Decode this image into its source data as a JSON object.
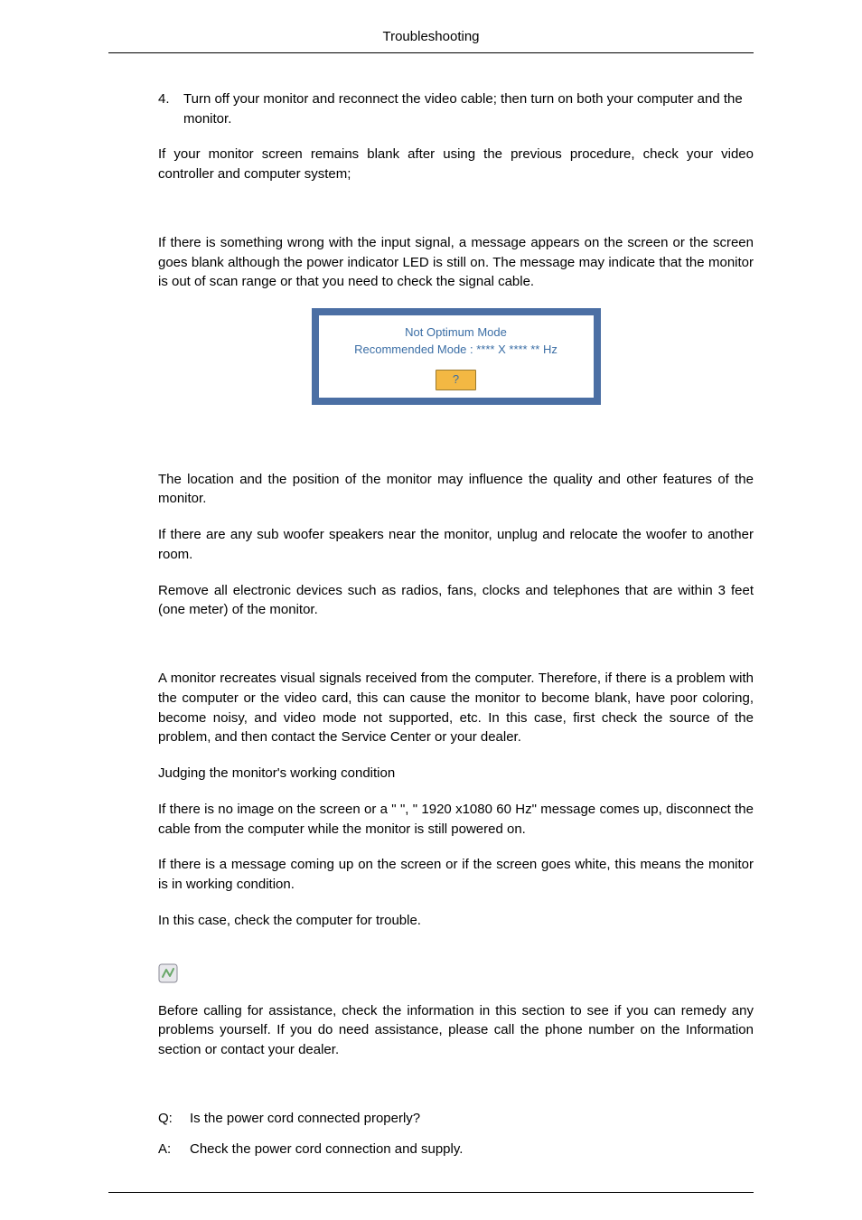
{
  "header": {
    "title": "Troubleshooting"
  },
  "step4": {
    "num": "4.",
    "text": "Turn off your monitor and reconnect the video cable; then turn on both your computer and the monitor."
  },
  "p_after_step": "If your monitor screen remains blank after using the previous procedure, check your video controller and computer system;",
  "p_signal": "If there is something wrong with the input signal, a message appears on the screen or the screen goes blank although the power indicator LED is still on. The message may indicate that the monitor is out of scan range or that you need to check the signal cable.",
  "dialog": {
    "line1": "Not Optimum Mode",
    "line2": "Recommended Mode : **** X **** ** Hz",
    "btn": "?"
  },
  "p_location": "The location and the position of the monitor may influence the quality and other features of the monitor.",
  "p_woofer": "If there are any sub woofer speakers near the monitor, unplug and relocate the woofer to another room.",
  "p_devices": "Remove all electronic devices such as radios, fans, clocks and telephones that are within 3 feet (one meter) of the monitor.",
  "p_recreates": "A monitor recreates visual signals received from the computer. Therefore, if there is a problem with the computer or the video card, this can cause the monitor to become blank, have poor coloring, become noisy, and video mode not supported, etc. In this case, first check the source of the problem, and then contact the Service Center or your dealer.",
  "p_judging": "Judging the monitor's working condition",
  "p_noimage": "If there is no image on the screen or a \"                                 \", \"                                           1920 x1080 60 Hz\" message comes up, disconnect the cable from the computer while the monitor is still powered on.",
  "p_ifmsg": "If there is a message coming up on the screen or if the screen goes white, this means the monitor is in working condition.",
  "p_checkcomp": "In this case, check the computer for trouble.",
  "p_before": "Before calling for assistance, check the information in this section to see if you can remedy any problems yourself. If you do need assistance, please call the phone number on the Information section or contact your dealer.",
  "qa": {
    "q_label": "Q:",
    "q_text": "Is the power cord connected properly?",
    "a_label": "A:",
    "a_text": "Check the power cord connection and supply."
  }
}
